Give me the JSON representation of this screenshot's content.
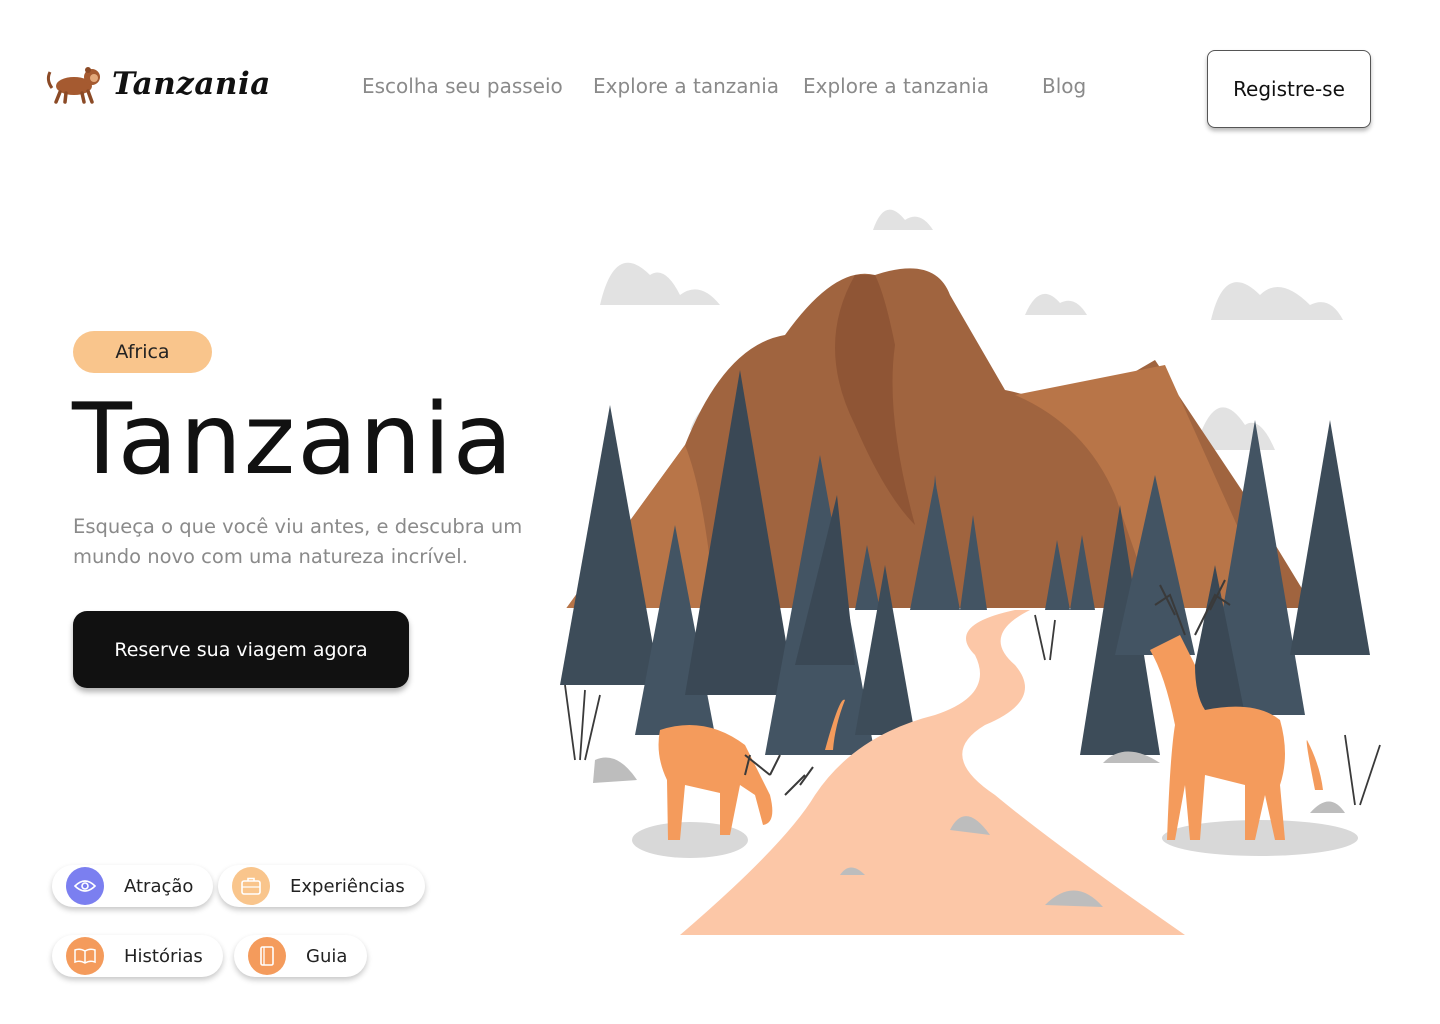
{
  "header": {
    "logo_text": "Tanzania",
    "logo_icon": "monkey-icon",
    "nav": [
      {
        "label": "Escolha seu passeio"
      },
      {
        "label": "Explore a tanzania"
      },
      {
        "label": "Explore a tanzania"
      },
      {
        "label": "Blog"
      }
    ],
    "register_label": "Registre-se"
  },
  "hero": {
    "badge": "Africa",
    "title": "Tanzania",
    "subtitle": "Esqueça o que você viu antes, e descubra um mundo novo com uma natureza incrível.",
    "cta_label": "Reserve sua viagem agora"
  },
  "chips": [
    {
      "label": "Atração",
      "icon": "eye-icon",
      "color": "#7b7ff0"
    },
    {
      "label": "Experiências",
      "icon": "briefcase-icon",
      "color": "#f9c58c"
    },
    {
      "label": "Histórias",
      "icon": "open-book-icon",
      "color": "#f49b5c"
    },
    {
      "label": "Guia",
      "icon": "book-icon",
      "color": "#f49b5c"
    }
  ],
  "colors": {
    "badge": "#f9c58c",
    "cta_bg": "#111111",
    "nav_text": "#8a8a8a",
    "mountain": "#a0643f",
    "tree": "#3d4c59",
    "deer": "#f49b5c",
    "path": "#fcc7a7"
  }
}
